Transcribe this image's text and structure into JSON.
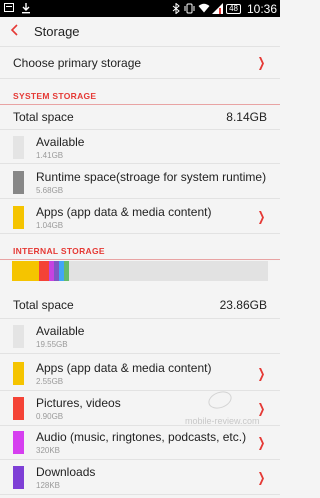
{
  "status_bar": {
    "time": "10:36",
    "battery": "48"
  },
  "header": {
    "title": "Storage"
  },
  "primary_storage": {
    "label": "Choose primary storage"
  },
  "system_storage": {
    "header": "SYSTEM STORAGE",
    "total_label": "Total space",
    "total_value": "8.14GB",
    "items": [
      {
        "label": "Available",
        "size": "1.41GB",
        "color": "#e4e4e4"
      },
      {
        "label": "Runtime space(stroage for system runtime)",
        "size": "5.68GB",
        "color": "#878787"
      },
      {
        "label": "Apps (app data & media content)",
        "size": "1.04GB",
        "color": "#f5c400"
      }
    ]
  },
  "internal_storage": {
    "header": "INTERNAL STORAGE",
    "total_label": "Total space",
    "total_value": "23.86GB",
    "usage_bar": [
      {
        "color": "#f5c400",
        "fraction": 0.107
      },
      {
        "color": "#f44336",
        "fraction": 0.038
      },
      {
        "color": "#c643e0",
        "fraction": 0.02
      },
      {
        "color": "#7e57c2",
        "fraction": 0.02
      },
      {
        "color": "#42a5f5",
        "fraction": 0.018
      },
      {
        "color": "#66bb6a",
        "fraction": 0.02
      }
    ],
    "items": [
      {
        "label": "Available",
        "size": "19.55GB",
        "color": "#e4e4e4"
      },
      {
        "label": "Apps (app data & media content)",
        "size": "2.55GB",
        "color": "#f5c400"
      },
      {
        "label": "Pictures, videos",
        "size": "0.90GB",
        "color": "#f44336"
      },
      {
        "label": "Audio (music, ringtones, podcasts, etc.)",
        "size": "320KB",
        "color": "#d63ff0"
      },
      {
        "label": "Downloads",
        "size": "128KB",
        "color": "#7e3fd6"
      }
    ]
  },
  "watermark": "mobile-review.com",
  "icons": {
    "status_left": [
      "notification-icon",
      "download-icon"
    ],
    "status_right": [
      "bluetooth-icon",
      "vibrate-icon",
      "wifi-icon",
      "signal-icon",
      "battery-icon"
    ],
    "chevron": "chevron-right-icon",
    "back": "back-arrow-icon"
  }
}
